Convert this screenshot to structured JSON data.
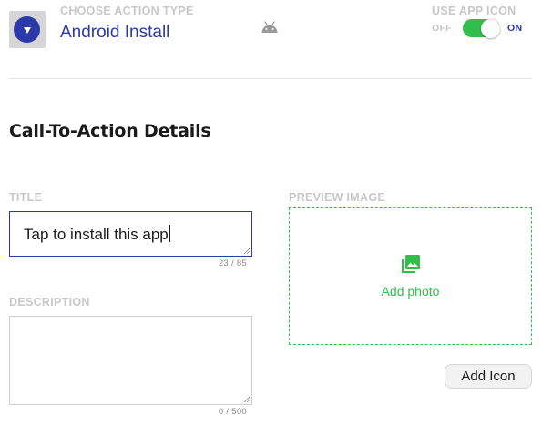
{
  "header": {
    "action_type_label": "CHOOSE ACTION TYPE",
    "action_type_value": "Android Install",
    "platform_icon": "android-icon",
    "use_app_icon_label": "USE APP ICON",
    "toggle_off_label": "OFF",
    "toggle_on_label": "ON",
    "use_app_icon_enabled": true
  },
  "section": {
    "title": "Call-To-Action Details"
  },
  "form": {
    "title_label": "TITLE",
    "title_value": "Tap to install this app",
    "title_counter": "23 / 85",
    "description_label": "DESCRIPTION",
    "description_value": "",
    "description_counter": "0 / 500",
    "preview_label": "PREVIEW IMAGE",
    "preview_icon": "photo-library-icon",
    "add_photo_label": "Add photo",
    "add_icon_label": "Add Icon"
  },
  "colors": {
    "accent_blue": "#2b3aa8",
    "accent_green": "#2fbf4a",
    "muted_label": "#c8c8c8"
  }
}
